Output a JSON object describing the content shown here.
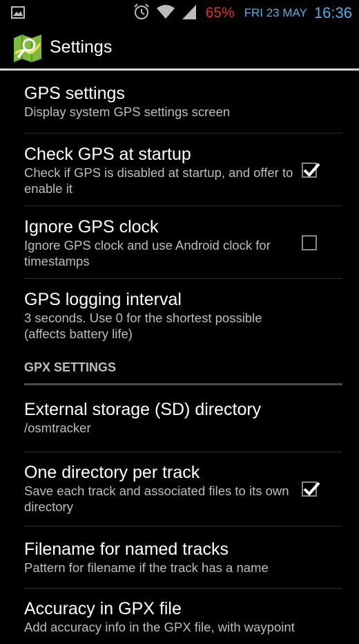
{
  "status_bar": {
    "notification_icon": "image-icon",
    "alarm_icon": "alarm-clock-icon",
    "wifi_icon": "wifi-icon",
    "signal_icon": "signal-icon",
    "battery": "65%",
    "date": "FRI 23 MAY",
    "time": "16:36",
    "colors": {
      "battery": "#e0302c",
      "clock": "#4fb0e8"
    }
  },
  "action_bar": {
    "icon": "osmtracker-map-icon",
    "title": "Settings"
  },
  "prefs": [
    {
      "title": "GPS settings",
      "summary": "Display system GPS settings screen"
    },
    {
      "title": "Check GPS at startup",
      "summary": "Check if GPS is disabled at startup, and offer to enable it",
      "checked": true
    },
    {
      "title": "Ignore GPS clock",
      "summary": "Ignore GPS clock and use Android clock for timestamps",
      "checked": false
    },
    {
      "title": "GPS logging interval",
      "summary": "3 seconds. Use 0 for the shortest possible (affects battery life)"
    }
  ],
  "category_gpx": "GPX SETTINGS",
  "gpx_prefs": [
    {
      "title": "External storage (SD) directory",
      "summary": "/osmtracker"
    },
    {
      "title": "One directory per track",
      "summary": "Save each track and associated files to its own directory",
      "checked": true
    },
    {
      "title": "Filename for named tracks",
      "summary": "Pattern for filename if the track has a name"
    },
    {
      "title": "Accuracy in GPX file",
      "summary": "Add accuracy info in the GPX file, with waypoint"
    }
  ]
}
